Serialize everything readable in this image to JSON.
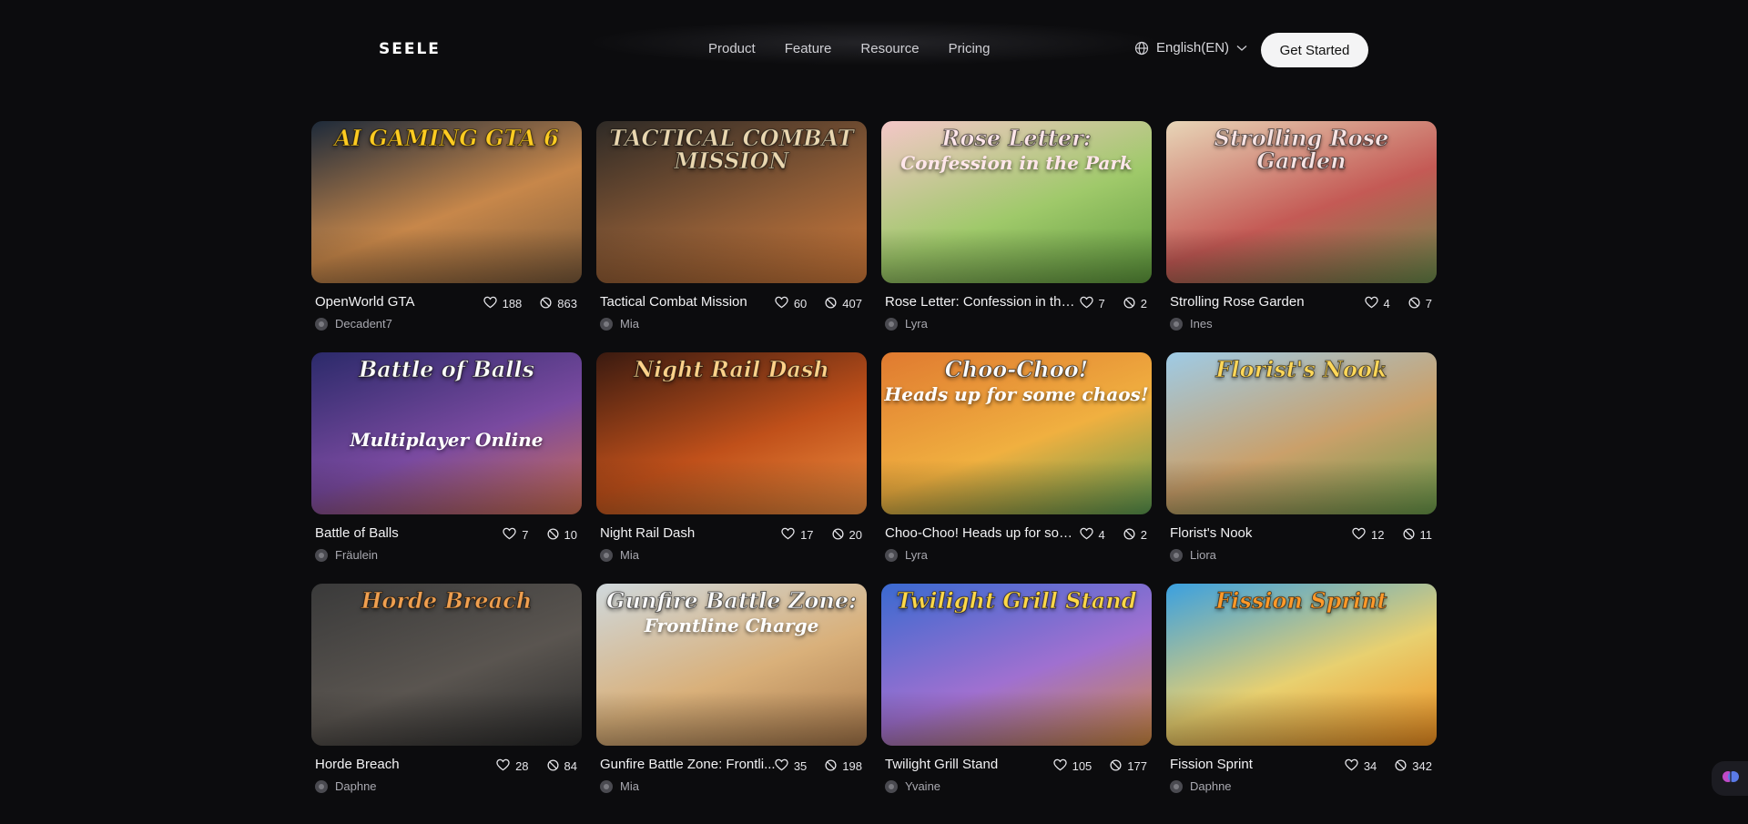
{
  "header": {
    "logo": "SEELE",
    "nav": [
      "Product",
      "Feature",
      "Resource",
      "Pricing"
    ],
    "language": "English(EN)",
    "cta": "Get Started"
  },
  "games": [
    {
      "title": "OpenWorld GTA",
      "author": "Decadent7",
      "likes": "188",
      "plays": "863",
      "thumb_text": "AI GAMING GTA 6",
      "thumb_sub": "",
      "colors": [
        "#1d2a3a",
        "#c7874a",
        "#7b5a3a"
      ],
      "title_color": "#ffcc22"
    },
    {
      "title": "Tactical Combat Mission",
      "author": "Mia",
      "likes": "60",
      "plays": "407",
      "thumb_text": "TACTICAL COMBAT MISSION",
      "thumb_sub": "",
      "colors": [
        "#2e2a26",
        "#8b5a35",
        "#d07a3a"
      ],
      "title_color": "#ead7b0"
    },
    {
      "title": "Rose Letter: Confession in the ...",
      "author": "Lyra",
      "likes": "7",
      "plays": "2",
      "thumb_text": "Rose Letter:",
      "thumb_sub": "Confession in the Park",
      "colors": [
        "#f4c7c8",
        "#9fc96a",
        "#5e9a3c"
      ],
      "title_color": "#ffe6ea"
    },
    {
      "title": "Strolling Rose Garden",
      "author": "Ines",
      "likes": "4",
      "plays": "7",
      "thumb_text": "Strolling Rose Garden",
      "thumb_sub": "",
      "colors": [
        "#e8d6b8",
        "#c45a55",
        "#6a8a4a"
      ],
      "title_color": "#f8e4e4"
    },
    {
      "title": "Battle of Balls",
      "author": "Fräulein",
      "likes": "7",
      "plays": "10",
      "thumb_text": "Battle of Balls",
      "thumb_sub": "Multiplayer Online",
      "colors": [
        "#2b2a6a",
        "#7a4aa0",
        "#d07050"
      ],
      "title_color": "#ffffff"
    },
    {
      "title": "Night Rail Dash",
      "author": "Mia",
      "likes": "17",
      "plays": "20",
      "thumb_text": "Night Rail Dash",
      "thumb_sub": "",
      "colors": [
        "#3a1a10",
        "#c0501a",
        "#f09040"
      ],
      "title_color": "#ffd28a"
    },
    {
      "title": "Choo-Choo! Heads up for som...",
      "author": "Lyra",
      "likes": "4",
      "plays": "2",
      "thumb_text": "Choo-Choo!",
      "thumb_sub": "Heads up for some chaos!",
      "colors": [
        "#e07a30",
        "#f0b040",
        "#5a9a50"
      ],
      "title_color": "#ffffff"
    },
    {
      "title": "Florist's Nook",
      "author": "Liora",
      "likes": "12",
      "plays": "11",
      "thumb_text": "Florist's Nook",
      "thumb_sub": "",
      "colors": [
        "#9ecbe6",
        "#caa06a",
        "#6a9a4a"
      ],
      "title_color": "#ffd85a"
    },
    {
      "title": "Horde Breach",
      "author": "Daphne",
      "likes": "28",
      "plays": "84",
      "thumb_text": "Horde Breach",
      "thumb_sub": "",
      "colors": [
        "#3a3a3a",
        "#5a5550",
        "#2a2a2a"
      ],
      "title_color": "#f0a050"
    },
    {
      "title": "Gunfire Battle Zone: Frontli...",
      "author": "Mia",
      "likes": "35",
      "plays": "198",
      "thumb_text": "Gunfire Battle Zone:",
      "thumb_sub": "Frontline Charge",
      "colors": [
        "#cfd8dc",
        "#d9b07a",
        "#a8784a"
      ],
      "title_color": "#ffffff"
    },
    {
      "title": "Twilight Grill Stand",
      "author": "Yvaine",
      "likes": "105",
      "plays": "177",
      "thumb_text": "Twilight Grill Stand",
      "thumb_sub": "",
      "colors": [
        "#3a6ad0",
        "#a070d0",
        "#d08a40"
      ],
      "title_color": "#ffd84a"
    },
    {
      "title": "Fission Sprint",
      "author": "Daphne",
      "likes": "34",
      "plays": "342",
      "thumb_text": "Fission Sprint",
      "thumb_sub": "",
      "colors": [
        "#3aa0e0",
        "#e8d070",
        "#f09020"
      ],
      "title_color": "#ff9a2a"
    }
  ],
  "icons": {
    "like": "heart-icon",
    "plays": "play-count-icon",
    "globe": "globe-icon",
    "chevron": "chevron-down-icon"
  }
}
